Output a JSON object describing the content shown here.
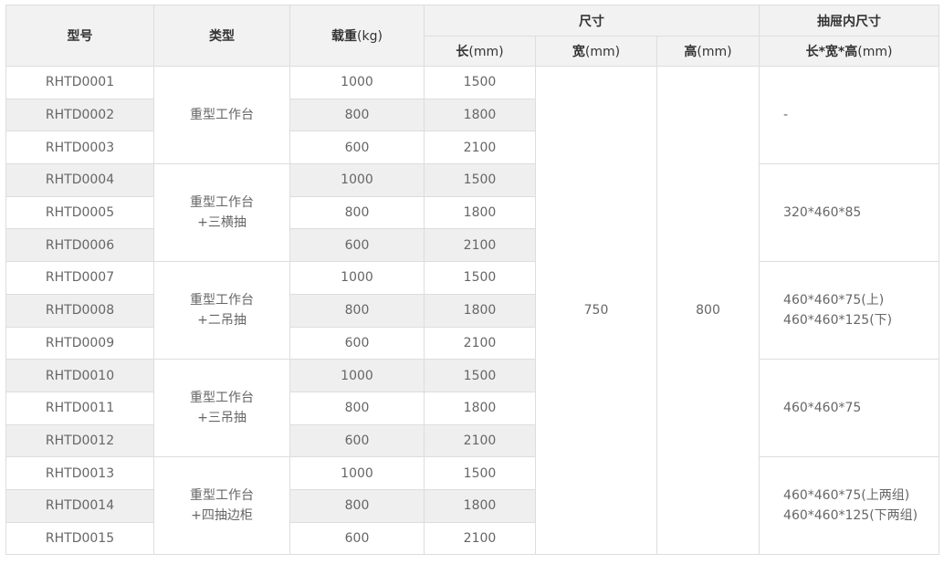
{
  "header": {
    "model": "型号",
    "type": "类型",
    "load_main": "载重",
    "load_unit": "(kg)",
    "size": "尺寸",
    "drawer_size": "抽屉内尺寸",
    "length_main": "长",
    "width_main": "宽",
    "height_main": "高",
    "mm_unit": "(mm)",
    "drawer_dims_main": "长*宽*高",
    "drawer_dims_unit": "(mm)"
  },
  "width_value": "750",
  "height_value": "800",
  "groups": [
    {
      "type_lines": [
        "重型工作台"
      ],
      "drawer_lines": [
        "-"
      ],
      "rows": [
        {
          "model": "RHTD0001",
          "load": "1000",
          "length": "1500"
        },
        {
          "model": "RHTD0002",
          "load": "800",
          "length": "1800"
        },
        {
          "model": "RHTD0003",
          "load": "600",
          "length": "2100"
        }
      ]
    },
    {
      "type_lines": [
        "重型工作台",
        "+三横抽"
      ],
      "drawer_lines": [
        "320*460*85"
      ],
      "rows": [
        {
          "model": "RHTD0004",
          "load": "1000",
          "length": "1500"
        },
        {
          "model": "RHTD0005",
          "load": "800",
          "length": "1800"
        },
        {
          "model": "RHTD0006",
          "load": "600",
          "length": "2100"
        }
      ]
    },
    {
      "type_lines": [
        "重型工作台",
        "+二吊抽"
      ],
      "drawer_lines": [
        "460*460*75(上)",
        "460*460*125(下)"
      ],
      "rows": [
        {
          "model": "RHTD0007",
          "load": "1000",
          "length": "1500"
        },
        {
          "model": "RHTD0008",
          "load": "800",
          "length": "1800"
        },
        {
          "model": "RHTD0009",
          "load": "600",
          "length": "2100"
        }
      ]
    },
    {
      "type_lines": [
        "重型工作台",
        "+三吊抽"
      ],
      "drawer_lines": [
        "460*460*75"
      ],
      "rows": [
        {
          "model": "RHTD0010",
          "load": "1000",
          "length": "1500"
        },
        {
          "model": "RHTD0011",
          "load": "800",
          "length": "1800"
        },
        {
          "model": "RHTD0012",
          "load": "600",
          "length": "2100"
        }
      ]
    },
    {
      "type_lines": [
        "重型工作台",
        "+四抽边柜"
      ],
      "drawer_lines": [
        "460*460*75(上两组)",
        "460*460*125(下两组)"
      ],
      "rows": [
        {
          "model": "RHTD0013",
          "load": "1000",
          "length": "1500"
        },
        {
          "model": "RHTD0014",
          "load": "800",
          "length": "1800"
        },
        {
          "model": "RHTD0015",
          "load": "600",
          "length": "2100"
        }
      ]
    }
  ]
}
